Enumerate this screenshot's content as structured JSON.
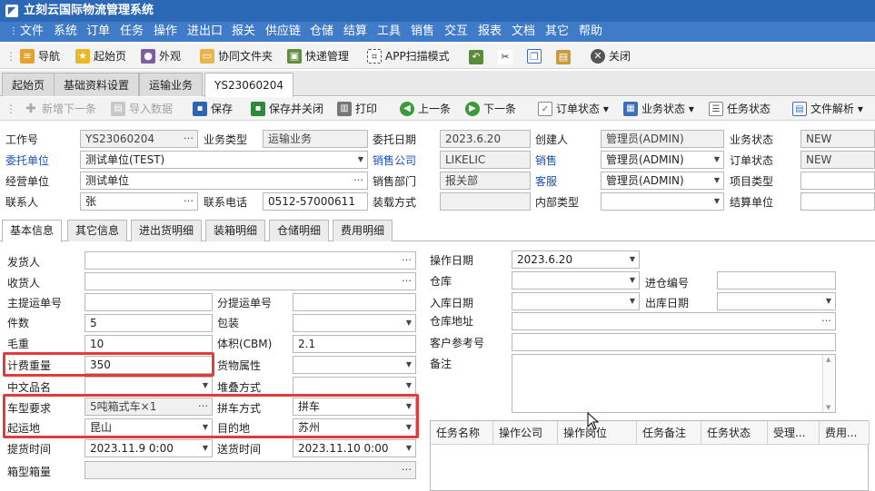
{
  "app": {
    "title": "立刻云国际物流管理系统"
  },
  "menu": [
    "文件",
    "系统",
    "订单",
    "任务",
    "操作",
    "进出口",
    "报关",
    "供应链",
    "仓储",
    "结算",
    "工具",
    "销售",
    "交互",
    "报表",
    "文档",
    "其它",
    "帮助"
  ],
  "toolbar1": {
    "nav": "导航",
    "home": "起始页",
    "look": "外观",
    "shared": "协同文件夹",
    "express": "快递管理",
    "app_scan": "APP扫描模式",
    "close": "关闭"
  },
  "tabs": [
    "起始页",
    "基础资料设置",
    "运输业务",
    "YS23060204"
  ],
  "toolbar2": {
    "new": "新增下一条",
    "import": "导入数据",
    "save": "保存",
    "save_close": "保存并关闭",
    "print": "打印",
    "prev": "上一条",
    "next": "下一条",
    "order_status": "订单状态",
    "biz_status": "业务状态",
    "task_status": "任务状态",
    "file_parse": "文件解析"
  },
  "header": {
    "job_no_label": "工作号",
    "job_no": "YS23060204",
    "biz_type_label": "业务类型",
    "biz_type": "运输业务",
    "entrust_date_label": "委托日期",
    "entrust_date": "2023.6.20",
    "creator_label": "创建人",
    "creator": "管理员(ADMIN)",
    "biz_status_label": "业务状态",
    "biz_status": "NEW",
    "client_label": "委托单位",
    "client": "测试单位(TEST)",
    "sales_company_label": "销售公司",
    "sales_company": "LIKELIC",
    "sales_label": "销售",
    "sales": "管理员(ADMIN)",
    "order_status_label": "订单状态",
    "order_status": "NEW",
    "operator_unit_label": "经营单位",
    "operator_unit": "测试单位",
    "sales_dept_label": "销售部门",
    "sales_dept": "报关部",
    "cs_label": "客服",
    "cs": "管理员(ADMIN)",
    "project_type_label": "项目类型",
    "contact_label": "联系人",
    "contact": "张",
    "phone_label": "联系电话",
    "phone": "0512-57000611",
    "load_method_label": "装载方式",
    "internal_type_label": "内部类型",
    "settle_unit_label": "结算单位"
  },
  "subtabs": [
    "基本信息",
    "其它信息",
    "进出货明细",
    "装箱明细",
    "仓储明细",
    "费用明细"
  ],
  "form": {
    "shipper_label": "发货人",
    "consignee_label": "收货人",
    "master_bill_label": "主提运单号",
    "house_bill_label": "分提运单号",
    "pieces_label": "件数",
    "pieces": "5",
    "packing_label": "包装",
    "gross_weight_label": "毛重",
    "gross_weight": "10",
    "volume_label": "体积(CBM)",
    "volume": "2.1",
    "charge_weight_label": "计费重量",
    "charge_weight": "350",
    "cargo_attr_label": "货物属性",
    "cn_name_label": "中文品名",
    "stack_label": "堆叠方式",
    "vehicle_label": "车型要求",
    "vehicle": "5吨箱式车×1",
    "consolidate_label": "拼车方式",
    "consolidate": "拼车",
    "origin_label": "起运地",
    "origin": "昆山",
    "dest_label": "目的地",
    "dest": "苏州",
    "pickup_time_label": "提货时间",
    "pickup_time": "2023.11.9 0:00",
    "delivery_time_label": "送货时间",
    "delivery_time": "2023.11.10 0:00",
    "container_label": "箱型箱量",
    "op_date_label": "操作日期",
    "op_date": "2023.6.20",
    "warehouse_label": "仓库",
    "in_no_label": "进仓编号",
    "in_date_label": "入库日期",
    "out_date_label": "出库日期",
    "wh_addr_label": "仓库地址",
    "cust_ref_label": "客户参考号",
    "remark_label": "备注"
  },
  "tasks": {
    "columns": [
      "任务名称",
      "操作公司",
      "操作岗位",
      "任务备注",
      "任务状态",
      "受理...",
      "费用..."
    ]
  }
}
